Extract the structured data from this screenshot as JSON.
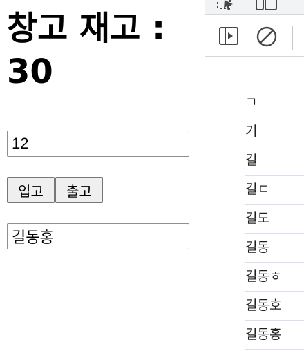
{
  "app": {
    "heading_line1": "창고 재고 :",
    "heading_line2": "30",
    "quantity_value": "12",
    "stock_in_label": "입고",
    "stock_out_label": "출고",
    "name_value": "길동홍"
  },
  "devtools": {
    "icons": [
      "inspect-icon",
      "device-toggle-icon",
      "sidebar-toggle-icon",
      "clear-console-icon"
    ],
    "console_log": [
      "ㄱ",
      "기",
      "길",
      "길ㄷ",
      "길도",
      "길동",
      "길동ㅎ",
      "길동호",
      "길동홍"
    ]
  }
}
